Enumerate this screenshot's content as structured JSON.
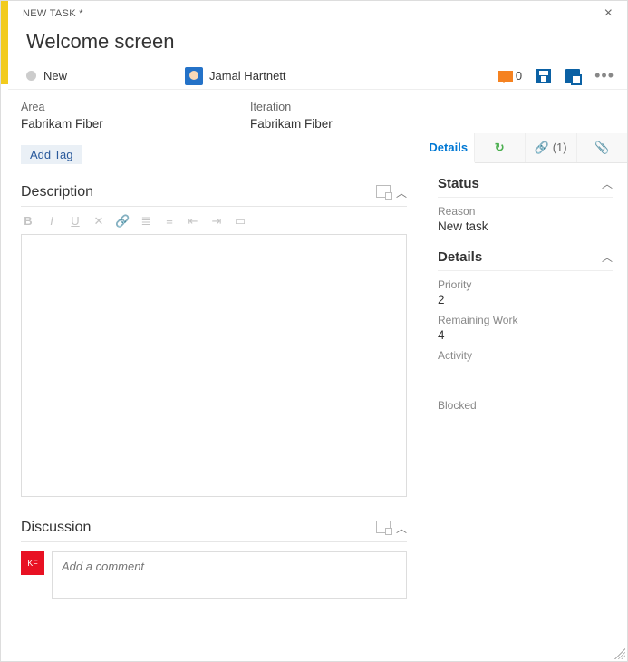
{
  "header": {
    "type_label": "NEW TASK *",
    "title": "Welcome screen",
    "state": "New",
    "assignee": "Jamal Hartnett",
    "comment_count": "0"
  },
  "fields": {
    "area_label": "Area",
    "area_value": "Fabrikam Fiber",
    "iteration_label": "Iteration",
    "iteration_value": "Fabrikam Fiber",
    "add_tag": "Add Tag"
  },
  "sections": {
    "description": "Description",
    "discussion": "Discussion"
  },
  "discussion": {
    "avatar_initials": "KF",
    "placeholder": "Add a comment"
  },
  "tabs": {
    "details": "Details",
    "links_count": "(1)"
  },
  "side": {
    "status_title": "Status",
    "reason_label": "Reason",
    "reason_value": "New task",
    "details_title": "Details",
    "priority_label": "Priority",
    "priority_value": "2",
    "remaining_label": "Remaining Work",
    "remaining_value": "4",
    "activity_label": "Activity",
    "blocked_label": "Blocked"
  }
}
